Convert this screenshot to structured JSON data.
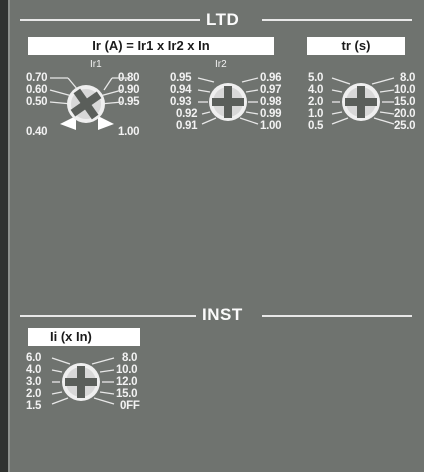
{
  "ltd": {
    "title": "LTD",
    "ir_label": "Ir (A) = Ir1 x Ir2 x In",
    "tr_label": "tr (s)",
    "ir1": {
      "name": "Ir1",
      "left": [
        "0.70",
        "0.60",
        "0.50",
        "0.40"
      ],
      "right": [
        "0.80",
        "0.90",
        "0.95",
        "1.00"
      ]
    },
    "ir2": {
      "name": "Ir2",
      "left": [
        "0.95",
        "0.94",
        "0.93",
        "0.92",
        "0.91"
      ],
      "right": [
        "0.96",
        "0.97",
        "0.98",
        "0.99",
        "1.00"
      ]
    },
    "tr": {
      "left": [
        "5.0",
        "4.0",
        "2.0",
        "1.0",
        "0.5"
      ],
      "right": [
        "8.0",
        "10.0",
        "15.0",
        "20.0",
        "25.0"
      ]
    }
  },
  "inst": {
    "title": "INST",
    "ii_label": "Ii (x In)",
    "ii": {
      "left": [
        "6.0",
        "4.0",
        "3.0",
        "2.0",
        "1.5"
      ],
      "right": [
        "8.0",
        "10.0",
        "12.0",
        "15.0",
        "0FF"
      ]
    }
  }
}
